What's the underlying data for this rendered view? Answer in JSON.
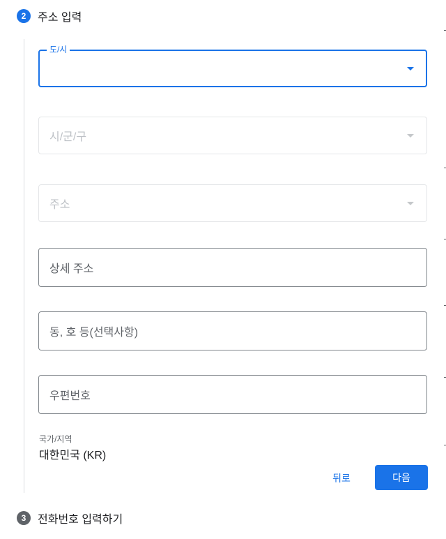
{
  "step2": {
    "number": "2",
    "title": "주소 입력",
    "badge_color": "#1a73e8"
  },
  "fields": {
    "province": {
      "label": "도/시"
    },
    "city": {
      "placeholder": "시/군/구"
    },
    "address": {
      "placeholder": "주소"
    },
    "detail": {
      "placeholder": "상세 주소"
    },
    "unit": {
      "placeholder": "동, 호 등(선택사항)"
    },
    "postal": {
      "placeholder": "우편번호"
    }
  },
  "country": {
    "label": "국가/지역",
    "value": "대한민국 (KR)"
  },
  "buttons": {
    "back": "뒤로",
    "next": "다음"
  },
  "step3": {
    "number": "3",
    "title": "전화번호 입력하기",
    "badge_color": "#5f6368"
  },
  "colors": {
    "accent": "#1a73e8",
    "disabled_border": "#e4e6e8",
    "border": "#80868b"
  },
  "icons": [
    "dropdown-arrow-icon"
  ]
}
